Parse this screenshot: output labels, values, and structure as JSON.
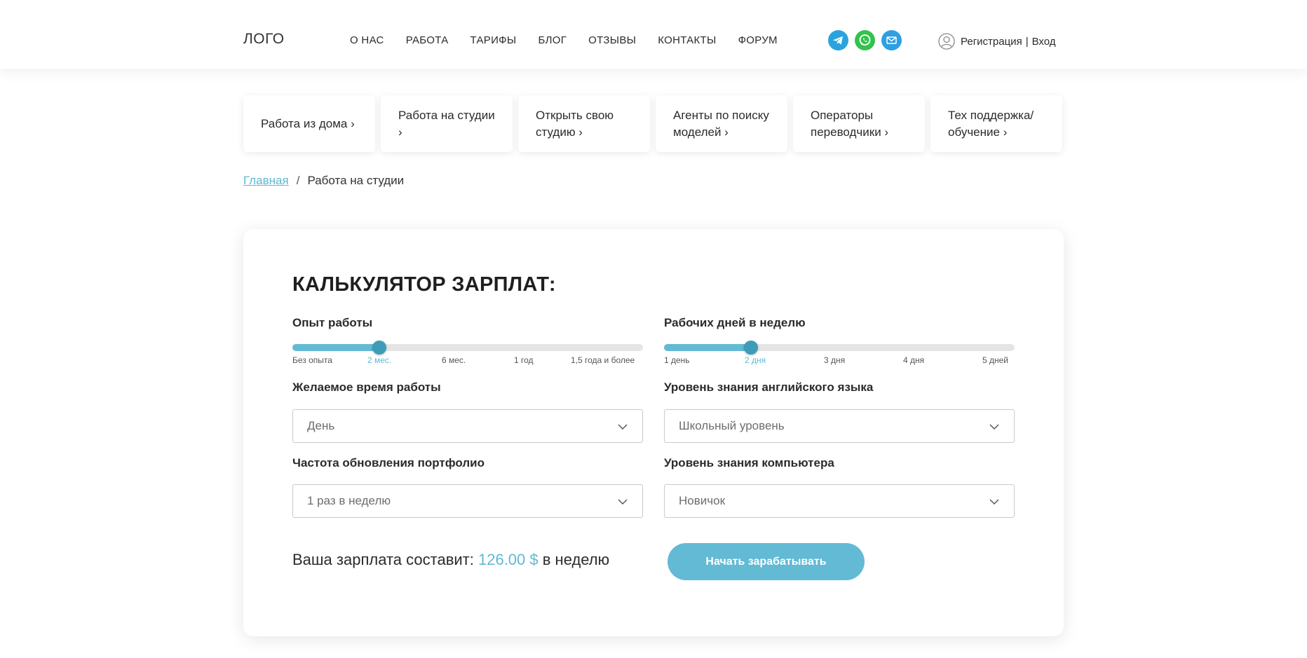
{
  "header": {
    "logo": "ЛОГО",
    "nav": [
      "О НАС",
      "РАБОТА",
      "ТАРИФЫ",
      "БЛОГ",
      "ОТЗЫВЫ",
      "КОНТАКТЫ",
      "ФОРУМ"
    ],
    "socials": [
      "telegram-icon",
      "whatsapp-icon",
      "mail-icon"
    ],
    "auth": {
      "register": "Регистрация",
      "separator": "|",
      "login": "Вход"
    }
  },
  "categories": [
    "Работа из дома ›",
    "Работа на студии ›",
    "Открыть свою студию ›",
    "Агенты по поиску моделей ›",
    "Операторы переводчики ›",
    "Тех поддержка/ обучение ›"
  ],
  "breadcrumb": {
    "home": "Главная",
    "separator": "/",
    "current": "Работа на студии"
  },
  "calculator": {
    "title": "КАЛЬКУЛЯТОР ЗАРПЛАТ:",
    "experience": {
      "label": "Опыт работы",
      "ticks": [
        "Без опыта",
        "2 мес.",
        "6 мес.",
        "1 год",
        "1,5 года и более"
      ],
      "selected_index": 1
    },
    "workdays": {
      "label": "Рабочих дней в неделю",
      "ticks": [
        "1 день",
        "2 дня",
        "3 дня",
        "4 дня",
        "5 дней"
      ],
      "selected_index": 1
    },
    "work_time": {
      "label": "Желаемое время работы",
      "value": "День"
    },
    "english": {
      "label": "Уровень знания английского языка",
      "value": "Школьный уровень"
    },
    "portfolio": {
      "label": "Частота обновления портфолио",
      "value": "1 раз в неделю"
    },
    "computer": {
      "label": "Уровень знания компьютера",
      "value": "Новичок"
    },
    "result": {
      "prefix": "Ваша зарплата составит:",
      "amount": "126.00 $",
      "suffix": "в неделю"
    },
    "cta": "Начать зарабатывать"
  },
  "colors": {
    "accent": "#62bad5",
    "thumb": "#3e9cb8",
    "track": "#e5e5e5"
  }
}
